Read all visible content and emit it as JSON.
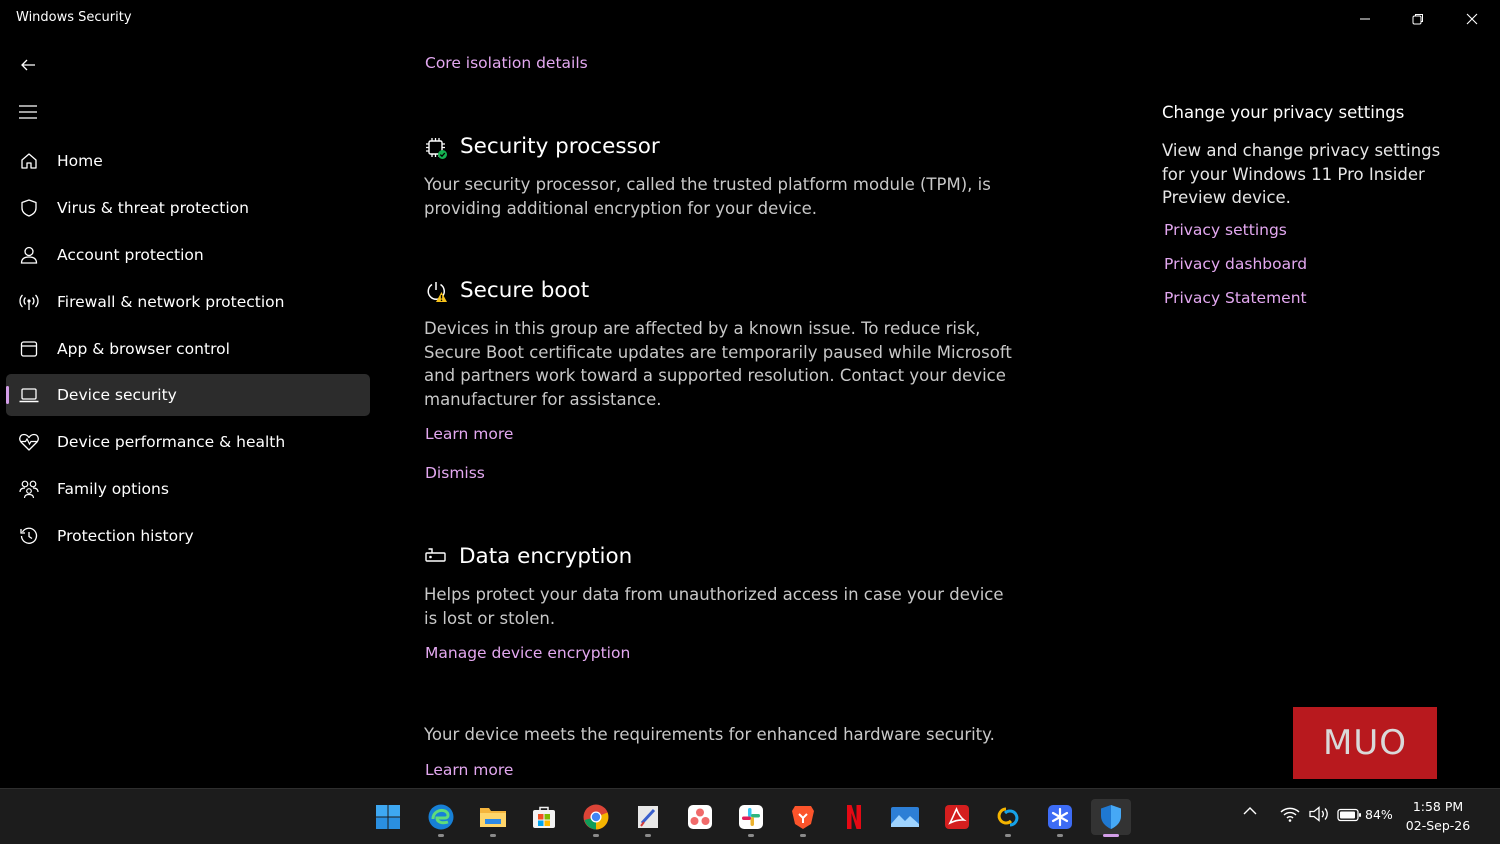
{
  "window": {
    "title": "Windows Security"
  },
  "nav": {
    "items": [
      {
        "label": "Home",
        "icon": "home-icon"
      },
      {
        "label": "Virus & threat protection",
        "icon": "shield-icon"
      },
      {
        "label": "Account protection",
        "icon": "person-icon"
      },
      {
        "label": "Firewall & network protection",
        "icon": "antenna-icon"
      },
      {
        "label": "App & browser control",
        "icon": "app-window-icon"
      },
      {
        "label": "Device security",
        "icon": "laptop-icon",
        "active": true
      },
      {
        "label": "Device performance & health",
        "icon": "heart-pulse-icon"
      },
      {
        "label": "Family options",
        "icon": "family-icon"
      },
      {
        "label": "Protection history",
        "icon": "history-icon"
      }
    ]
  },
  "main": {
    "core_isolation_link": "Core isolation details",
    "security_processor": {
      "title": "Security processor",
      "description": "Your security processor, called the trusted platform module (TPM), is providing additional encryption for your device."
    },
    "secure_boot": {
      "title": "Secure boot",
      "description": "Devices in this group are affected by a known issue. To reduce risk, Secure Boot certificate updates are temporarily paused while Microsoft and partners work toward a supported resolution. Contact your device manufacturer for assistance.",
      "learn_more": "Learn more",
      "dismiss": "Dismiss"
    },
    "data_encryption": {
      "title": "Data encryption",
      "description": "Helps protect your data from unauthorized access in case your device is lost or stolen.",
      "manage_link": "Manage device encryption"
    },
    "hardware_summary": {
      "text": "Your device meets the requirements for enhanced hardware security.",
      "learn_more": "Learn more"
    }
  },
  "sidepanel": {
    "title": "Change your privacy settings",
    "description": "View and change privacy settings for your Windows 11 Pro Insider Preview device.",
    "links": [
      "Privacy settings",
      "Privacy dashboard",
      "Privacy Statement"
    ]
  },
  "watermark": {
    "text": "MUO"
  },
  "taskbar": {
    "apps": [
      "start-icon",
      "edge-icon",
      "file-explorer-icon",
      "store-icon",
      "chrome-icon",
      "paint-icon",
      "asana-icon",
      "slack-icon",
      "brave-icon",
      "netflix-icon",
      "photos-icon",
      "acrobat-icon",
      "link-app-icon",
      "snowflake-app-icon",
      "windows-security-icon"
    ],
    "battery": "84%",
    "time": "1:58 PM",
    "date": "02-Sep-26"
  },
  "colors": {
    "accent": "#d39ee8",
    "link": "#e3a8f0",
    "background": "#000000"
  }
}
